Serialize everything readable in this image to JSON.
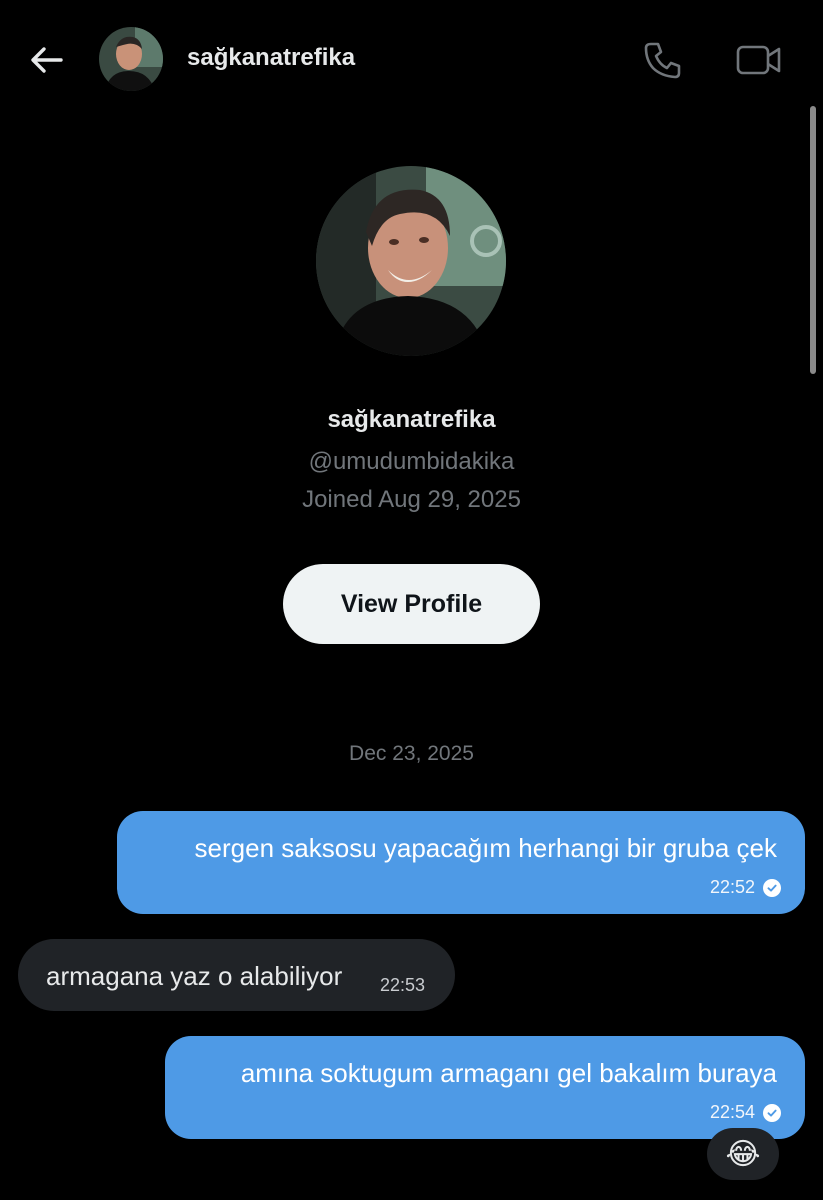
{
  "header": {
    "title": "sağkanatrefika",
    "back_icon": "arrow-left-icon",
    "call_icon": "phone-icon",
    "video_icon": "video-camera-icon"
  },
  "profile": {
    "name": "sağkanatrefika",
    "handle": "@umudumbidakika",
    "joined": "Joined Aug 29, 2025",
    "button_label": "View Profile"
  },
  "conversation": {
    "date": "Dec 23, 2025",
    "messages": [
      {
        "direction": "out",
        "text": "sergen saksosu yapacağım herhangi bir gruba çek",
        "time": "22:52",
        "status": "seen"
      },
      {
        "direction": "in",
        "text": "armagana yaz o alabiliyor",
        "time": "22:53"
      },
      {
        "direction": "out",
        "text": "amına soktugum armaganı gel bakalım buraya",
        "time": "22:54",
        "status": "seen",
        "reaction": "😂"
      }
    ]
  },
  "colors": {
    "background": "#000000",
    "outgoing_bubble": "#4e9ae6",
    "incoming_bubble": "#202327",
    "muted_text": "#71767b",
    "button_bg": "#eff3f4"
  }
}
